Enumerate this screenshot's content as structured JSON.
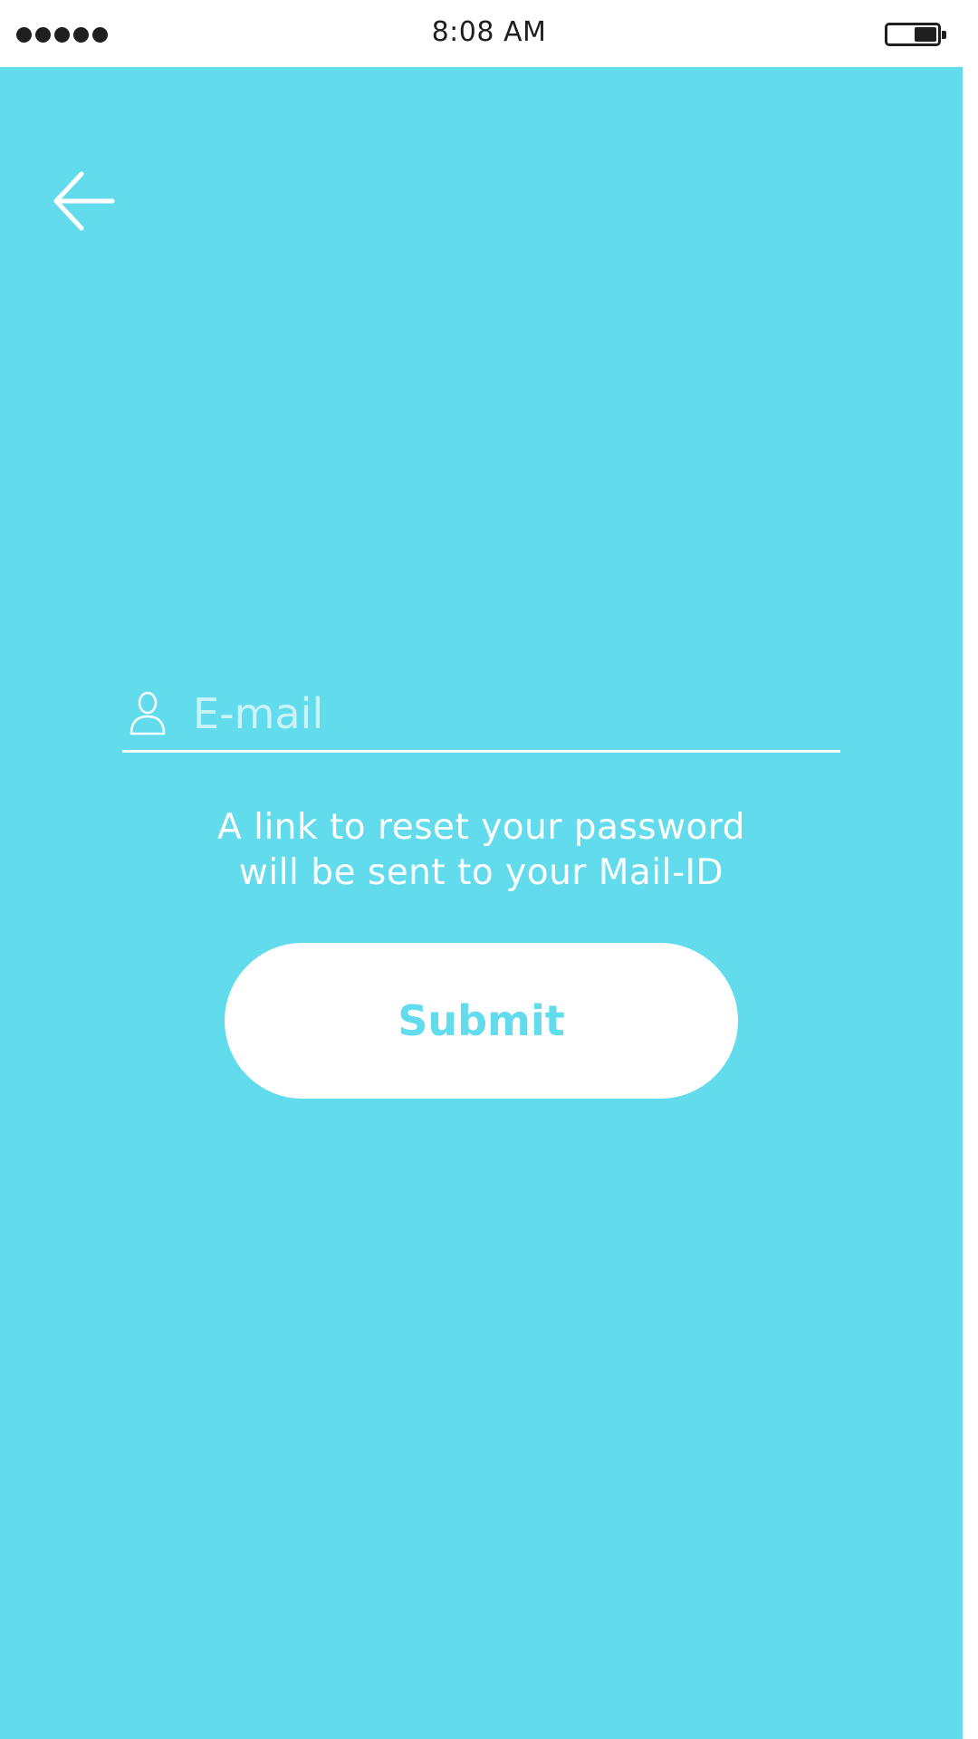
{
  "status_bar": {
    "time": "8:08 AM",
    "signal_icon": "signal-dots-icon",
    "battery_icon": "battery-icon"
  },
  "header": {
    "back_icon": "arrow-left-icon"
  },
  "form": {
    "email_icon": "user-icon",
    "email_placeholder": "E-mail",
    "email_value": "",
    "info_line_1": "A link to reset your password",
    "info_line_2": "will be sent to your Mail-ID",
    "submit_label": "Submit"
  },
  "colors": {
    "background": "#62dced",
    "foreground": "#ffffff",
    "status_text": "#1f1f1f"
  }
}
